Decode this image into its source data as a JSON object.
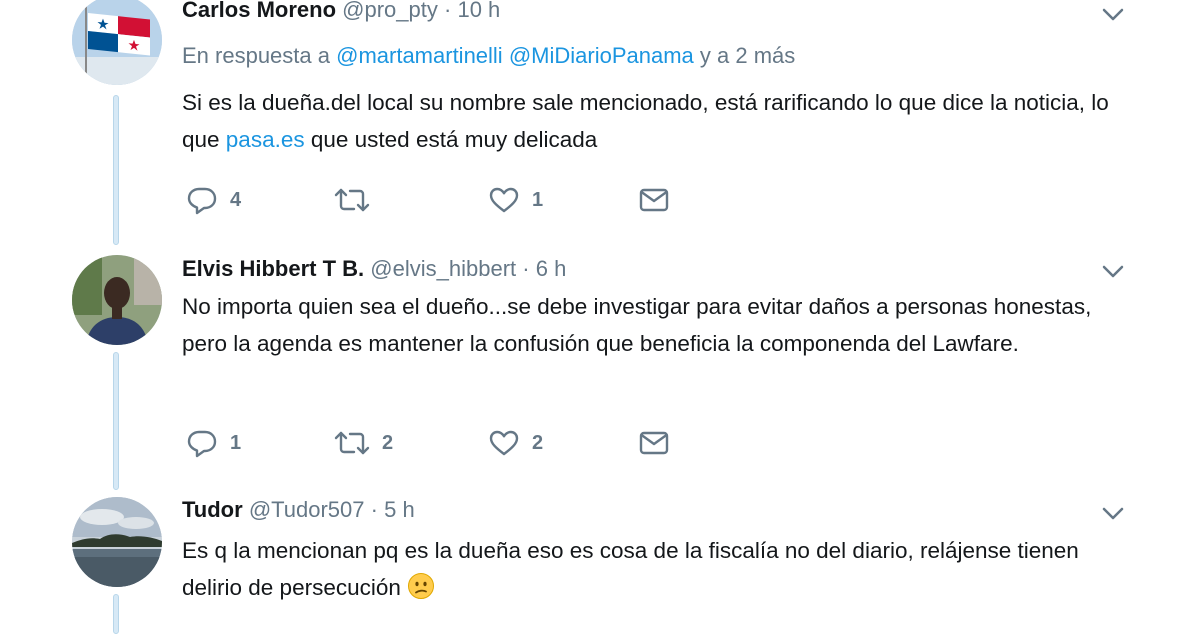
{
  "tweets": [
    {
      "name": "Carlos Moreno",
      "handle": "@pro_pty",
      "separator": "·",
      "time": "10 h",
      "reply_prefix": "En respuesta a",
      "reply_mentions": [
        "@martamartinelli",
        "@MiDiarioPanama"
      ],
      "reply_suffix": "y a 2 más",
      "text_before_link": "Si es la dueña.del local su nombre sale mencionado, está rarificando lo que dice la noticia, lo que ",
      "link_text": "pasa.es",
      "text_after_link": " que usted está muy delicada",
      "actions": {
        "replies": "4",
        "retweets": "",
        "likes": "1"
      }
    },
    {
      "name": "Elvis Hibbert T B.",
      "handle": "@elvis_hibbert",
      "separator": "·",
      "time": "6 h",
      "text": "No importa quien sea el dueño...se debe investigar para evitar daños a personas honestas, pero la agenda es mantener la confusión que beneficia la componenda del Lawfare.",
      "actions": {
        "replies": "1",
        "retweets": "2",
        "likes": "2"
      }
    },
    {
      "name": "Tudor",
      "handle": "@Tudor507",
      "separator": "·",
      "time": "5 h",
      "text": "Es q la mencionan pq es la dueña eso es cosa de la fiscalía no del diario, relájense tienen delirio de persecución",
      "emoji": "confused-face"
    }
  ],
  "colors": {
    "accent": "#1b95e0",
    "muted": "#657786",
    "text": "#14171a",
    "thread": "#d7e9f6"
  },
  "icons": [
    "reply-icon",
    "retweet-icon",
    "like-icon",
    "direct-message-icon",
    "chevron-down-icon",
    "confused-face-emoji"
  ]
}
